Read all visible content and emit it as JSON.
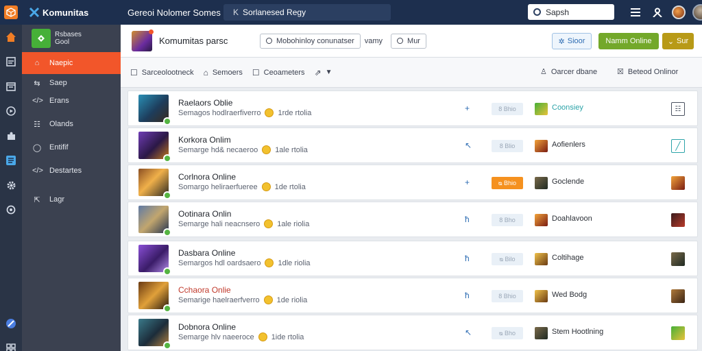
{
  "topbar": {
    "brand": "Komunitas",
    "title": "Gereoi Nolomer Somes",
    "search": "Sorlanesed Regy",
    "search_right_placeholder": "Sapsh"
  },
  "sidebar": {
    "header_line1": "Rsbases",
    "header_line2": "Gool",
    "items": [
      {
        "label": "Naepic",
        "icon": "home"
      },
      {
        "label": "Saep",
        "icon": "swap"
      },
      {
        "label": "Erans",
        "icon": "code"
      },
      {
        "label": "Olands",
        "icon": "grid"
      },
      {
        "label": "Entifif",
        "icon": "circle"
      },
      {
        "label": "Destartes",
        "icon": "code"
      },
      {
        "label": "Lagr",
        "icon": "cursor"
      }
    ]
  },
  "header": {
    "title": "Komumitas parsc",
    "filter": "Mobohinloy conunatser",
    "word": "vamy",
    "pill2": "Mur",
    "btn_blue": "Sioor",
    "btn_green": "Namm Online",
    "btn_olive": "Sur"
  },
  "toolbar": {
    "item1": "Sarceolootneck",
    "item2": "Semoers",
    "item3": "Ceoameters",
    "right1": "Oarcer dbane",
    "right2": "Beteod Onlinor"
  },
  "rows": [
    {
      "title": "Raelaors Oblie",
      "sub": "Semagos hodlraerfiverro",
      "status": "1rde rtolia",
      "mid": "+",
      "badge": "8 Bhio",
      "badge_style": "plain",
      "game": "Coonsiey",
      "game_style": "teal",
      "thumb": "blue",
      "end": "box",
      "game_icon": "green"
    },
    {
      "title": "Korkora Onlim",
      "sub": "Semarge hd& necaeroo",
      "status": "1ale rtolia",
      "mid": "↖",
      "badge": "8 Blio",
      "badge_style": "plain",
      "game": "Aofienlers",
      "game_style": "plain",
      "thumb": "purple",
      "end": "teal-box",
      "game_icon": "fire"
    },
    {
      "title": "Corlnora Online",
      "sub": "Somargo heliraerfueree",
      "status": "1de rtolia",
      "mid": "+",
      "badge": "ᴓ Bhio",
      "badge_style": "orange",
      "game": "Goclende",
      "game_style": "plain",
      "thumb": "orange",
      "end": "fire",
      "game_icon": "dark"
    },
    {
      "title": "Ootinara Onlin",
      "sub": "Semarge hali neacnsero",
      "status": "1ale riolia",
      "mid": "ħ",
      "badge": "8 Bho",
      "badge_style": "plain",
      "game": "Doahlavoon",
      "game_style": "plain",
      "thumb": "steel",
      "end": "dark-red",
      "game_icon": "fire"
    },
    {
      "title": "Dasbara Online",
      "sub": "Semargos hdl oardsaero",
      "status": "1dle riolia",
      "mid": "ħ",
      "badge": "ᴓ Bilo",
      "badge_style": "plain",
      "game": "Coltihage",
      "game_style": "plain",
      "thumb": "violet",
      "end": "dark",
      "game_icon": "gold"
    },
    {
      "title": "Cchaora Onlie",
      "sub": "Semarige haelraerfverro",
      "status": "1de riolia",
      "mid": "ħ",
      "badge": "8 Bhio",
      "badge_style": "plain",
      "game": "Wed Bodg",
      "game_style": "plain",
      "thumb": "gold",
      "end": "bronze",
      "game_icon": "gold"
    },
    {
      "title": "Dobnora Online",
      "sub": "Semarge hlv naeeroce",
      "status": "1ide rtolia",
      "mid": "↖",
      "badge": "ᴓ Bho",
      "badge_style": "plain",
      "game": "Stem Hootlning",
      "game_style": "plain",
      "thumb": "teal",
      "end": "green",
      "game_icon": "dark"
    }
  ],
  "colors": {
    "accent_orange": "#f2562a",
    "topbar": "#1d2f4e",
    "sidebar": "#3b4150",
    "green_button": "#73a82a",
    "olive_button": "#b89a17"
  }
}
